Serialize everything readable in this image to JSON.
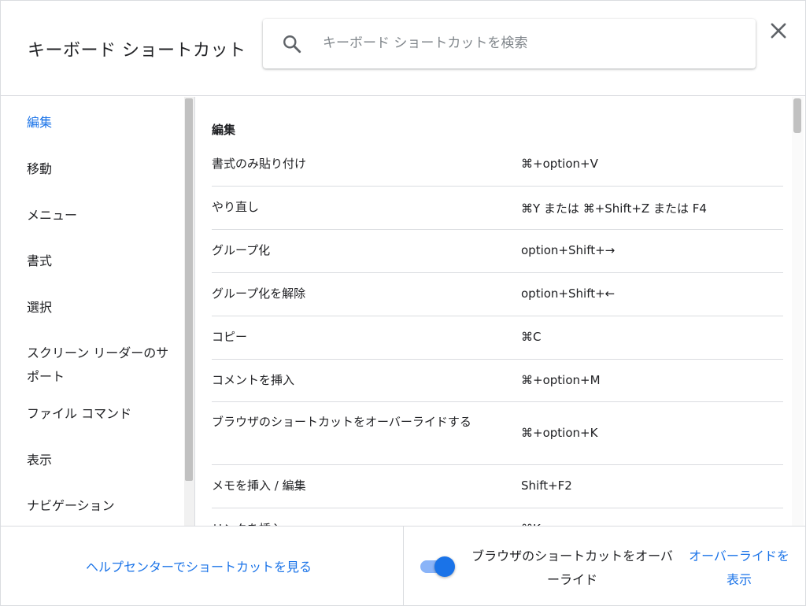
{
  "header": {
    "title": "キーボード ショートカット",
    "search_placeholder": "キーボード ショートカットを検索"
  },
  "sidebar": {
    "items": [
      {
        "label": "編集",
        "active": true
      },
      {
        "label": "移動"
      },
      {
        "label": "メニュー"
      },
      {
        "label": "書式"
      },
      {
        "label": "選択"
      },
      {
        "label": "スクリーン リーダーのサポート"
      },
      {
        "label": "ファイル コマンド"
      },
      {
        "label": "表示"
      },
      {
        "label": "ナビゲーション"
      }
    ]
  },
  "main": {
    "section_title": "編集",
    "rows": [
      {
        "name": "書式のみ貼り付け",
        "keys": "⌘+option+V"
      },
      {
        "name": "やり直し",
        "keys": "⌘Y または ⌘+Shift+Z または F4"
      },
      {
        "name": "グループ化",
        "keys": "option+Shift+→"
      },
      {
        "name": "グループ化を解除",
        "keys": "option+Shift+←"
      },
      {
        "name": "コピー",
        "keys": "⌘C"
      },
      {
        "name": "コメントを挿入",
        "keys": "⌘+option+M"
      },
      {
        "name": "ブラウザのショートカットをオーバーライドする",
        "keys": "⌘+option+K"
      },
      {
        "name": "メモを挿入 / 編集",
        "keys": "Shift+F2"
      },
      {
        "name": "リンクを挿入",
        "keys": "⌘K"
      }
    ]
  },
  "footer": {
    "help_link": "ヘルプセンターでショートカットを見る",
    "toggle_label": "ブラウザのショートカットをオーバーライド",
    "toggle_on": true,
    "show_link": "オーバーライドを表示"
  },
  "colors": {
    "accent": "#1a73e8",
    "toggle_track": "#8ab4f8",
    "divider": "#dadce0",
    "text": "#202124"
  }
}
